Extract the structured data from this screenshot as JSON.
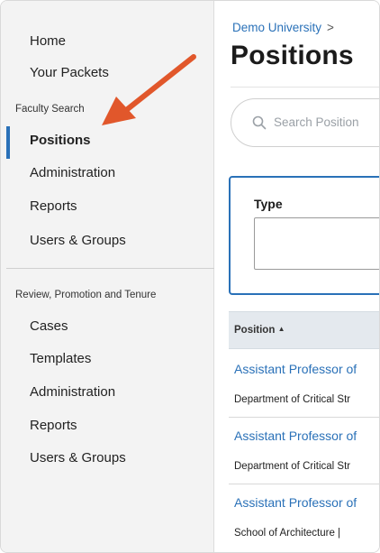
{
  "sidebar": {
    "top_items": [
      {
        "label": "Home"
      },
      {
        "label": "Your Packets"
      }
    ],
    "sections": [
      {
        "title": "Faculty Search",
        "items": [
          {
            "label": "Positions",
            "active": true
          },
          {
            "label": "Administration"
          },
          {
            "label": "Reports"
          },
          {
            "label": "Users & Groups"
          }
        ]
      },
      {
        "title": "Review, Promotion and Tenure",
        "items": [
          {
            "label": "Cases"
          },
          {
            "label": "Templates"
          },
          {
            "label": "Administration"
          },
          {
            "label": "Reports"
          },
          {
            "label": "Users & Groups"
          }
        ]
      }
    ]
  },
  "main": {
    "breadcrumb": {
      "label": "Demo University",
      "separator": ">"
    },
    "title": "Positions",
    "search": {
      "placeholder": "Search Position"
    },
    "filter": {
      "label": "Type",
      "value": ""
    },
    "table": {
      "columns": [
        {
          "label": "Position",
          "sort": "ascending",
          "sort_glyph": "▲"
        }
      ],
      "rows": [
        {
          "title": "Assistant Professor of",
          "sub": "Department of Critical Str"
        },
        {
          "title": "Assistant Professor of",
          "sub": "Department of Critical Str"
        },
        {
          "title": "Assistant Professor of",
          "sub": "School of Architecture  |"
        }
      ]
    }
  },
  "colors": {
    "accent": "#2a71b8",
    "annotation_arrow": "#e1572b"
  }
}
